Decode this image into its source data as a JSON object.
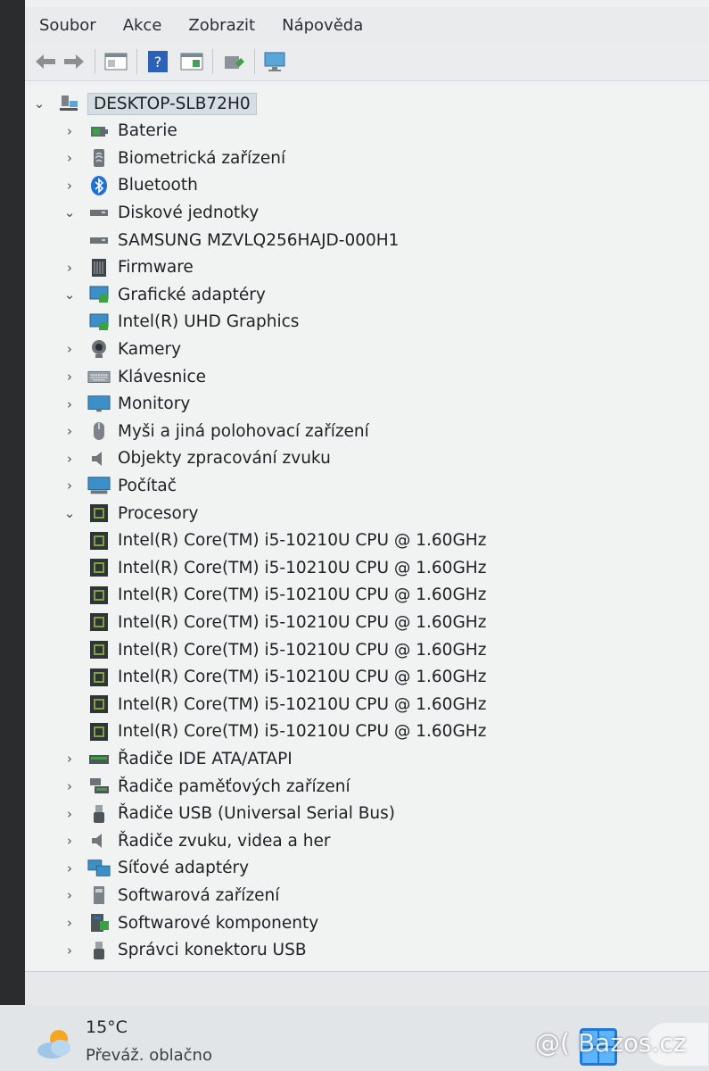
{
  "menubar": {
    "items": [
      "Soubor",
      "Akce",
      "Zobrazit",
      "Nápověda"
    ]
  },
  "toolbar": {
    "buttons": [
      "back-arrow-icon",
      "forward-arrow-icon",
      "properties-pane-icon",
      "help-icon",
      "view-pane-icon",
      "update-driver-icon",
      "monitor-scan-icon"
    ]
  },
  "tree": {
    "root": "DESKTOP-SLB72H0",
    "nodes": [
      {
        "label": "Baterie",
        "state": "collapsed",
        "icon": "battery-icon"
      },
      {
        "label": "Biometrická zařízení",
        "state": "collapsed",
        "icon": "fingerprint-icon"
      },
      {
        "label": "Bluetooth",
        "state": "collapsed",
        "icon": "bluetooth-icon"
      },
      {
        "label": "Diskové jednotky",
        "state": "expanded",
        "icon": "disk-drive-icon"
      },
      {
        "label": "SAMSUNG MZVLQ256HAJD-000H1",
        "state": "child",
        "icon": "disk-drive-icon"
      },
      {
        "label": "Firmware",
        "state": "collapsed",
        "icon": "firmware-icon"
      },
      {
        "label": "Grafické adaptéry",
        "state": "expanded",
        "icon": "display-adapter-icon"
      },
      {
        "label": "Intel(R) UHD Graphics",
        "state": "child",
        "icon": "display-adapter-icon"
      },
      {
        "label": "Kamery",
        "state": "collapsed",
        "icon": "camera-icon"
      },
      {
        "label": "Klávesnice",
        "state": "collapsed",
        "icon": "keyboard-icon"
      },
      {
        "label": "Monitory",
        "state": "collapsed",
        "icon": "monitor-icon"
      },
      {
        "label": "Myši a jiná polohovací zařízení",
        "state": "collapsed",
        "icon": "mouse-icon"
      },
      {
        "label": "Objekty zpracování zvuku",
        "state": "collapsed",
        "icon": "speaker-icon"
      },
      {
        "label": "Počítač",
        "state": "collapsed",
        "icon": "computer-icon"
      },
      {
        "label": "Procesory",
        "state": "expanded",
        "icon": "processor-icon"
      },
      {
        "label": "Intel(R) Core(TM) i5-10210U CPU @ 1.60GHz",
        "state": "child",
        "icon": "processor-icon"
      },
      {
        "label": "Intel(R) Core(TM) i5-10210U CPU @ 1.60GHz",
        "state": "child",
        "icon": "processor-icon"
      },
      {
        "label": "Intel(R) Core(TM) i5-10210U CPU @ 1.60GHz",
        "state": "child",
        "icon": "processor-icon"
      },
      {
        "label": "Intel(R) Core(TM) i5-10210U CPU @ 1.60GHz",
        "state": "child",
        "icon": "processor-icon"
      },
      {
        "label": "Intel(R) Core(TM) i5-10210U CPU @ 1.60GHz",
        "state": "child",
        "icon": "processor-icon"
      },
      {
        "label": "Intel(R) Core(TM) i5-10210U CPU @ 1.60GHz",
        "state": "child",
        "icon": "processor-icon"
      },
      {
        "label": "Intel(R) Core(TM) i5-10210U CPU @ 1.60GHz",
        "state": "child",
        "icon": "processor-icon"
      },
      {
        "label": "Intel(R) Core(TM) i5-10210U CPU @ 1.60GHz",
        "state": "child",
        "icon": "processor-icon"
      },
      {
        "label": "Řadiče IDE ATA/ATAPI",
        "state": "collapsed",
        "icon": "ide-controller-icon"
      },
      {
        "label": "Řadiče paměťových zařízení",
        "state": "collapsed",
        "icon": "storage-controller-icon"
      },
      {
        "label": "Řadiče USB (Universal Serial Bus)",
        "state": "collapsed",
        "icon": "usb-icon"
      },
      {
        "label": "Řadiče zvuku, videa a her",
        "state": "collapsed",
        "icon": "speaker-icon"
      },
      {
        "label": "Síťové adaptéry",
        "state": "collapsed",
        "icon": "network-adapter-icon"
      },
      {
        "label": "Softwarová zařízení",
        "state": "collapsed",
        "icon": "software-device-icon"
      },
      {
        "label": "Softwarové komponenty",
        "state": "collapsed",
        "icon": "software-component-icon"
      },
      {
        "label": "Správci konektoru USB",
        "state": "collapsed",
        "icon": "usb-icon"
      }
    ]
  },
  "taskbar": {
    "temperature": "15°C",
    "condition": "Převáž. oblačno",
    "weather_icon": "cloud-sun-icon"
  },
  "watermark": "@( Bazos.cz"
}
